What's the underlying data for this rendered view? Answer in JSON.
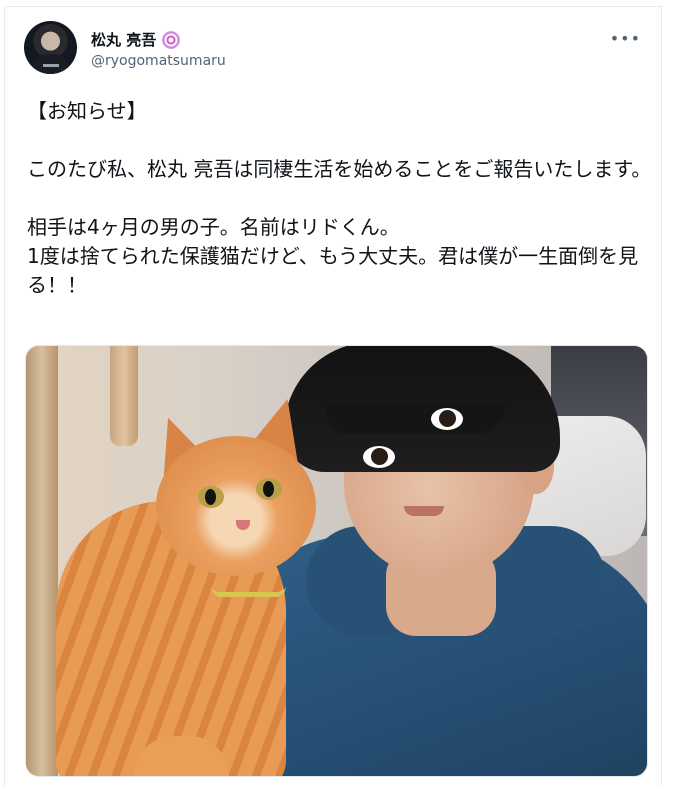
{
  "tweet": {
    "author": {
      "display_name": "松丸 亮吾",
      "handle": "@ryogomatsumaru",
      "badge_icon": "verified-badge-icon"
    },
    "more_label": "•••",
    "text": "【お知らせ】\n\nこのたび私、松丸 亮吾は同棲生活を始めることをご報告いたします。\n\n相手は4ヶ月の男の子。名前はリドくん。\n1度は捨てられた保護猫だけど、もう大丈夫。君は僕が一生面倒を見る！！",
    "media": {
      "icon": "photo-icon"
    }
  },
  "theme": {
    "text_color": "#0f1419",
    "muted_color": "#536471",
    "border_color": "#e6ecf0"
  }
}
